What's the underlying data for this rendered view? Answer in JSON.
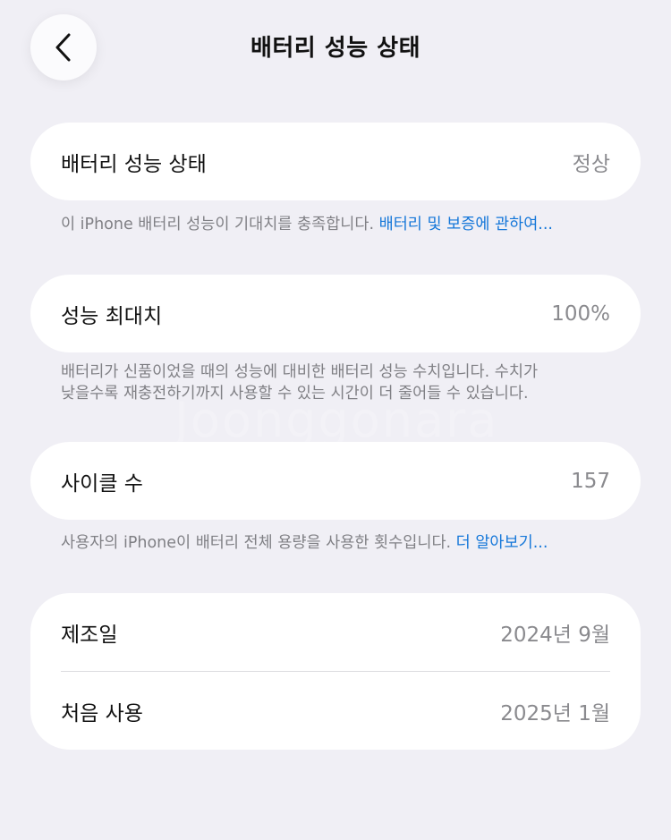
{
  "header": {
    "title": "배터리 성능 상태"
  },
  "battery_health": {
    "label": "배터리 성능 상태",
    "value": "정상",
    "note_text": "이 iPhone 배터리 성능이 기대치를 충족합니다. ",
    "note_link": "배터리 및 보증에 관하여..."
  },
  "max_capacity": {
    "label": "성능 최대치",
    "value": "100%",
    "note_line1": "배터리가 신품이었을 때의 성능에 대비한 배터리 성능 수치입니다. 수치가",
    "note_line2": "낮을수록 재충전하기까지 사용할 수 있는 시간이 더 줄어들 수 있습니다."
  },
  "cycle_count": {
    "label": "사이클 수",
    "value": "157",
    "note_text": "사용자의 iPhone이 배터리 전체 용량을 사용한 횟수입니다. ",
    "note_link": "더 알아보기..."
  },
  "dates": {
    "manufacture_label": "제조일",
    "manufacture_value": "2024년 9월",
    "first_use_label": "처음 사용",
    "first_use_value": "2025년 1월"
  },
  "watermark": "Joonggonara",
  "icons": {
    "back": "chevron-left-icon"
  },
  "colors": {
    "background": "#f0eff5",
    "card": "#ffffff",
    "link": "#1577d9",
    "secondary_text": "#8a8a8e"
  }
}
